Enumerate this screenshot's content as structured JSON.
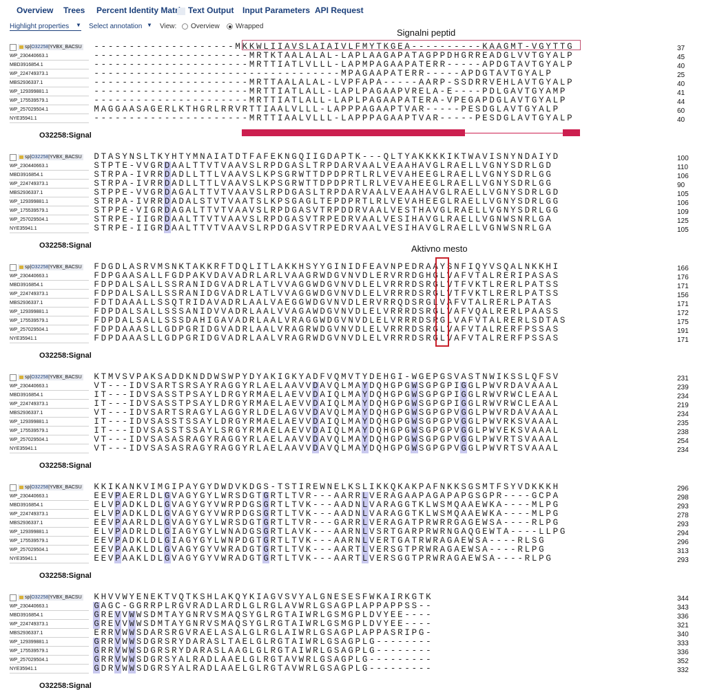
{
  "tabs": [
    "Overview",
    "Trees",
    "Percent Identity Matrix",
    "Text Output",
    "Input Parameters",
    "API Request"
  ],
  "options": {
    "highlight": "Highlight properties",
    "annotation": "Select annotation",
    "view_label": "View:",
    "view_overview": "Overview",
    "view_wrapped": "Wrapped",
    "view_selected": "Wrapped"
  },
  "annotations": {
    "signal": "Signalni peptid",
    "active": "Aktivno mesto"
  },
  "track_label": "O32258:Signal",
  "colors": {
    "signal_bar": "#cc1f4f",
    "box": "#c8202a",
    "link": "#1b3f7a"
  },
  "sequences": [
    {
      "db": "sp",
      "acc": "O32258",
      "id": "YVBX_BACSU"
    },
    {
      "name": "WP_230440663.1"
    },
    {
      "name": "MBD3916854.1"
    },
    {
      "name": "WP_224749373.1"
    },
    {
      "name": "MBS2936337.1"
    },
    {
      "name": "WP_129399881.1"
    },
    {
      "name": "WP_175539579.1"
    },
    {
      "name": "WP_257029504.1"
    },
    {
      "name": "NYE35941.1"
    }
  ],
  "blocks": [
    {
      "rows": [
        "--------------------MKKWLIIAVSLAIAIVLFMYTKGEA----------KAAGMT-VGYTTG",
        "----------------------MRTKTAALALAL-LAPLAAGAPATAGPPDHGRREADGLVVTGYALP",
        "----------------------MRTTIATLVLLL-LAPMPAGAAPATERR-----APDGTAVTGYALP",
        "-----------------------------------MPAGAAPATERR-----APDGTAVTGYALP",
        "----------------------MRTTAALALAL-LVPFAPA-----AARP-SSDRRVEHLAVTGYALP",
        "----------------------MRTTIATLALL-LAPLPAGAAPVRELA-E----PDLGAVTGYAMP",
        "----------------------MRTTIATLALL-LAPLPAGAAPATERA-VPEGAPDGLAVTGYALP",
        "MAGGAASAGERLKTHGRLRRVRTTIAALVLLL-LAPPPAGAAPTVAR-----PESDGLAVTGYALP",
        "----------------------MRTTIAALVLLL-LAPPPAGAAPTVAR-----PESDGLAVTGYALP"
      ],
      "nums": [
        "37",
        "45",
        "40",
        "25",
        "40",
        "41",
        "44",
        "60",
        "40"
      ]
    },
    {
      "rows": [
        "DTASYNSLTKYHTYMNAIATDTFAFEKNGQIIGDAPTK---QLTYAKKKKIKTWAVISNYNDAIYD",
        "STPTE-VVGRDAALTTVTVAAVSLRPDGASLTRPDARVAALVEAAHAVGLRAELLVGNYSDRLGD",
        "STRPA-IVRRDADLLTTLVAAVSLKPSGRWTTDPDPRTLRLVEVAHEEGLRAELLVGNYSDRLGG",
        "STRPA-IVRRDADLLTTLVAAVSLKPSGRWTTDPDPRTLRLVEVAHEEGLRAELLVGNYSDRLGG",
        "STPPE-VVGRDAGALTTVTVAAVSLRPDGASLTRPDARVAALVEAAHAVGLRAELLVGNYSDRLGD",
        "STRPA-IVRRDADALSTVTVAATSLKPSGAGLTEPDPRTLRLVEVAHEEGLRAELLVGNYSDRLGG",
        "STPPE-VIGRDAGALTTVTVAAVSLRPDGASVTRPDDRVAALVESTHAVGLRAELLVGNYSDRLGG",
        "STRPE-IIGRDAALTTVTVAAVSLRPDGASVTRPEDRVAALVESIHAVGLRAELLVGNWSNRLGA",
        "STRPE-IIGRDAALTTVTVAAVSLRPDGASVTRPEDRVAALVESIHAVGLRAELLVGNWSNRLGA"
      ],
      "nums": [
        "100",
        "110",
        "106",
        "90",
        "105",
        "106",
        "109",
        "125",
        "105"
      ]
    },
    {
      "rows": [
        "FDGDLASRVMSNKTAKKRFTDQLITLAKKHSYYGINIDFEAVNPEDRAAYSNFIQYVSQALNKKHI",
        "FDPGAASALLFGDPAKVDAVADRLARLVAAGRWDGVNVDLERVRRDGHGLVAFVTALRERIPASAS",
        "FDPDALSALLSSRANIDGVADRLATLVVAGGWDGVNVDLELVRRRDSRGLVTFVKTLRERLPATSS",
        "FDPDALSALLSSRANIDGVADRLATLVVAGGWDGVNVDLELVRRRDSRGLVTFVKTLRERLPATSS",
        "FDTDAAALLSSQTRIDAVADRLAALVAEGGWDGVNVDLERVRRQDSRGLVAFVTALRERLPATAS",
        "FDPDALSALLSSSANIDVVADRLAALVVAGAWDGVNVDLELVRRRDSRGLVAFVQALRERLPAASS",
        "FDPDALSALLSSSDAHIGAVADRLAALVRAGGWDGVNVDLELVRRRDSRGLVAFVTALRERLSDTAS",
        "FDPDAAASLLGDPGRIDGVADRLAALVRAGRWDGVNVDLELVRRRDSRGLVAFVTALRERFPSSAS",
        "FDPDAAASLLGDPGRIDGVADRLAALVRAGRWDGVNVDLELVRRRDSRGLVAFVTALRERFPSSAS"
      ],
      "nums": [
        "166",
        "176",
        "171",
        "156",
        "171",
        "172",
        "175",
        "191",
        "171"
      ]
    },
    {
      "rows": [
        "KTMVSVPAKSADDKNDDWSWPYDYAKIGKYADFVQMVTYDEHGI-WGEPGSVASTNWIKSSLQFSV",
        "VT---IDVSARTSRSAYRAGGYRLAELAAVVDAVQLMAYDQHGPGWSGPGPIGGLPWVRDAVAAAL",
        "IT---IDVSASSTPSAYLDRGYRMAELAEVVDAIQLMAYDQHGPGWSGPGPIGGLRWVRWCLEAAL",
        "IT---IDVSASSTPSAYLDRGYRMAELAEVVDAIQLMAYDQHGPGWSGPGPIGGLRWVRWCLEAAL",
        "VT---IDVSARTSRAGYLAGGYRLDELAGVVDAVQLMAYDQHGPGWSGPGPVGGLPWVRDAVAAAL",
        "IT---IDVSASSTSSAYLDRGYRMAELAEVVDAIQLMAYDQHGPGWSGPGPVGGLPWVRKSVAAAL",
        "IT---IDVSASSTSSAYLSRGYRMAELAEVVDAIQLMAYDQHGPGWSGPGPVGGLPWVEKSVAAAL",
        "VT---IDVSASASRAGYRAGGYRLAELAAVVDAVQLMAYDQHGPGWSGPGPVGGLPWVRTSVAAAL",
        "VT---IDVSASASRAGYRAGGYRLAELAAVVDAVQLMAYDQHGPGWSGPGPVGGLPWVRTSVAAAL"
      ],
      "nums": [
        "231",
        "239",
        "234",
        "219",
        "234",
        "235",
        "238",
        "254",
        "234"
      ]
    },
    {
      "rows": [
        "KKIKANKVIMGIPAYGYDWDVKDGS-TSTIREWNELKSLIKKQKAKPAFNKKSGSMTFSYVDKKKH",
        "EEVPAERLDLGVAGYGYLWRSDGTGRTLTVR---AARRLVERAGAAPAGAPAPGSGPR----GCPA",
        "ELVPADKLDLGVAGYGYVWRPDGSGRTLTVK---AADNLVARAGGTKLWSMQAAEWKA----MLPG",
        "ELVPADKLDLGVAGYGYVWRPDGSGRTLTVK---AADNLVARAGGTKLWSMQAAEWKA----MLPG",
        "EEVPAARLDLGVAGYGYLWRSDGTGRTLTVR---GARRLVERAGATPRWRRGAGEWSA----RLPG",
        "ELVPADRLDLGIAGYGYLWNADGSGRTLAVK---AARNLVSRTGARPRWRNGAQGEWTA----LLPG",
        "EEVPADKLDLGIAGYGYLWNPDGTGRTLTVK---AARNLVERTGATRWRAGAEWSA----RLSG",
        "EEVPAAKLDLGVAGYGYVWRADGTGRTLTVK---AARTLVERSGTPRWRAGAEWSA----RLPG",
        "EEVPAAKLDLGVAGYGYVWRADGTGRTLTVK---AARTLVERSGGTPRWRAGAEWSA----RLPG"
      ],
      "nums": [
        "296",
        "298",
        "293",
        "278",
        "293",
        "294",
        "296",
        "313",
        "293"
      ]
    },
    {
      "rows": [
        "KHVVWYENEKTVQTKSHLAKQYKIAGVSVYALGNESESFWKAIRKGTK",
        "GAGC-GGRRPLRGVRADLARDLGLRGLAVWRLGSAGPLAPPAPPSS--",
        "GREVVWWSDMTAYGNRVSMAQSYGLRGTAIWRLGSMGPLDVYEE----",
        "GREVVWWSDMTAYGNRVSMAQSYGLRGTAIWRLGSMGPLDVYEE----",
        "ERRVWWSDARSRGVRAELASALGLRGLAIWRLGSAGPLAPPASRIPG-",
        "GRRVWWSDGRSRYDARASLTAELGLRGTAIWRLGSAGPLG--------",
        "GRRVWWSDGRSRYDARASLAAGLGLRGTAIWRLGSAGPLG--------",
        "GRRVWWSDGRSYALRADLAAELGLRGTAVWRLGSAGPLG---------",
        "GDRVWWSDGRSYALRADLAAELGLRGTAVWRLGSAGPLG---------"
      ],
      "nums": [
        "344",
        "343",
        "336",
        "321",
        "340",
        "333",
        "336",
        "352",
        "332"
      ]
    }
  ]
}
